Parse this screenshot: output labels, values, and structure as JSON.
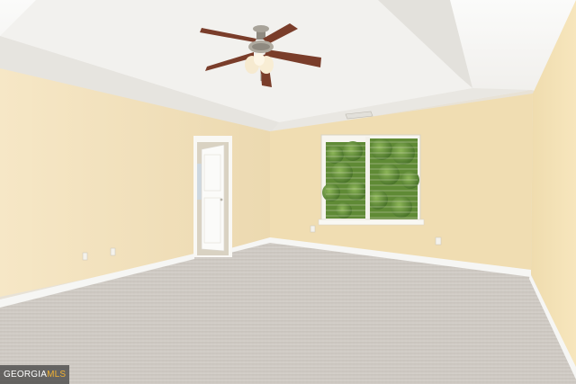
{
  "watermark": {
    "brand": "GEORGIA",
    "suffix": "MLS"
  },
  "colors": {
    "wall_left": "#f3e3bf",
    "wall_back": "#f1dfb6",
    "wall_right": "#f4e2b6",
    "ceiling": "#f7f6f3",
    "carpet": "#cfcac3",
    "baseboard": "#f4f4f2",
    "foliage": "#4f7a2b",
    "fan_blade": "#7a3d2a"
  }
}
